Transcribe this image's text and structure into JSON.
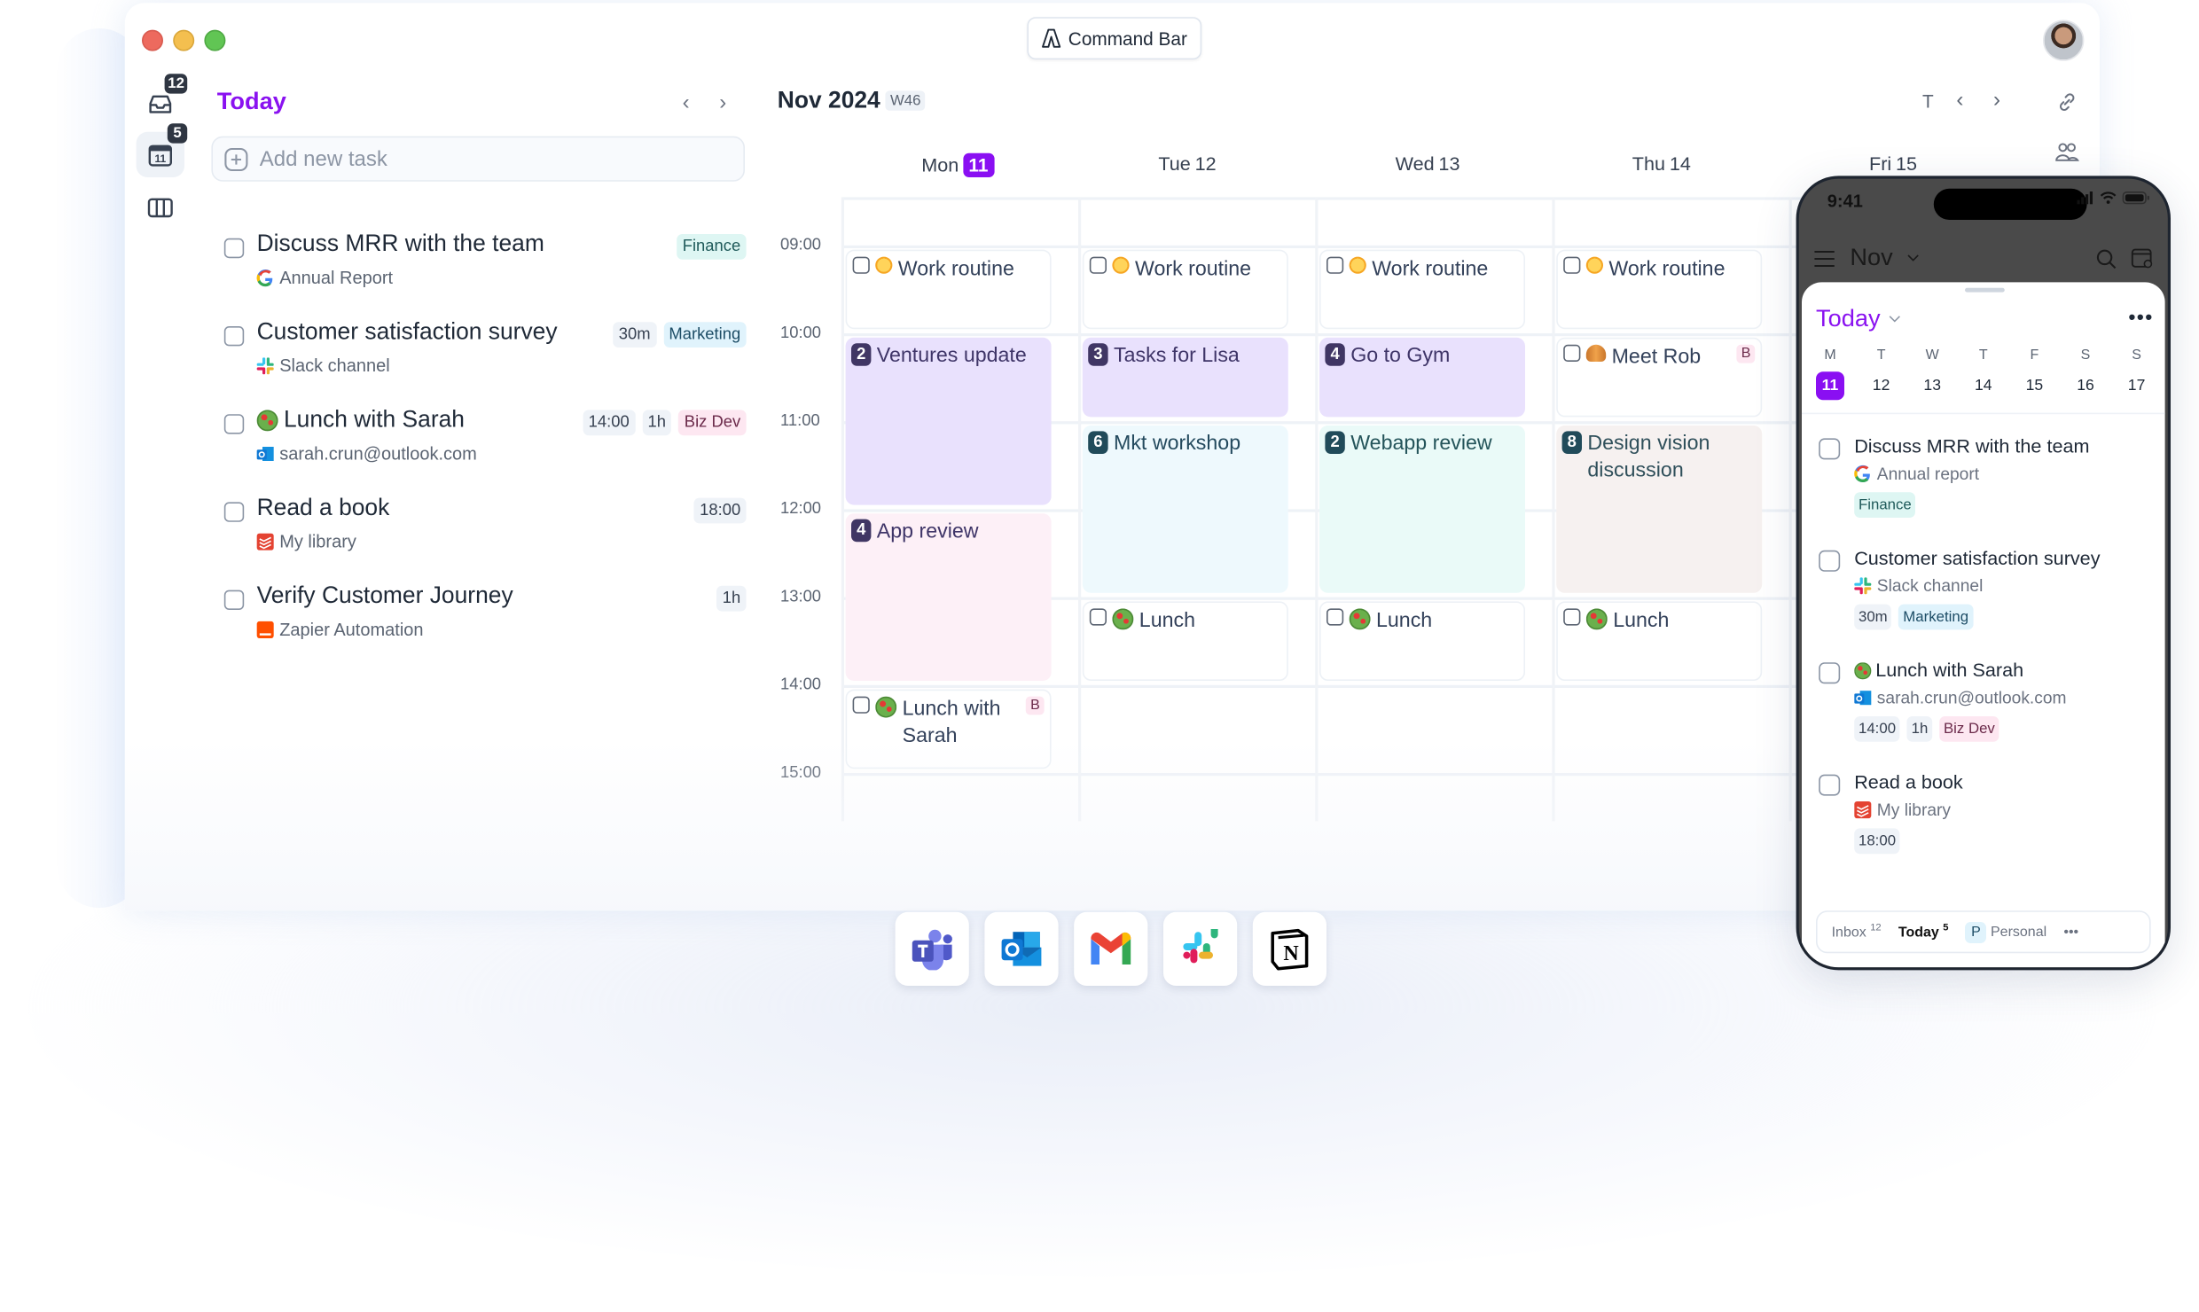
{
  "window": {
    "command_bar_label": "Command Bar",
    "avatar_alt": "User avatar"
  },
  "sidebar": {
    "items": [
      {
        "name": "inbox",
        "icon": "inbox-icon",
        "badge": "12"
      },
      {
        "name": "today",
        "icon": "calendar-day-icon",
        "badge": "5",
        "calendar_day": "11",
        "active": true
      },
      {
        "name": "boards",
        "icon": "columns-icon"
      }
    ]
  },
  "today_panel": {
    "title": "Today",
    "prev_label": "‹",
    "next_label": "›",
    "add_task_placeholder": "Add new task",
    "tasks": [
      {
        "title": "Discuss MRR with the team",
        "source_icon": "google-icon",
        "source": "Annual Report",
        "tags": [
          {
            "label": "Finance",
            "kind": "finance"
          }
        ]
      },
      {
        "title": "Customer satisfaction survey",
        "source_icon": "slack-icon",
        "source": "Slack channel",
        "tags": [
          {
            "label": "30m",
            "kind": "plain"
          },
          {
            "label": "Marketing",
            "kind": "marketing"
          }
        ]
      },
      {
        "title": "Lunch with Sarah",
        "emoji": "salad-icon",
        "source_icon": "outlook-icon",
        "source": "sarah.crun@outlook.com",
        "tags": [
          {
            "label": "14:00",
            "kind": "plain"
          },
          {
            "label": "1h",
            "kind": "plain"
          },
          {
            "label": "Biz Dev",
            "kind": "bizdev"
          }
        ]
      },
      {
        "title": "Read a book",
        "source_icon": "todoist-icon",
        "source": "My library",
        "tags": [
          {
            "label": "18:00",
            "kind": "plain"
          }
        ]
      },
      {
        "title": "Verify Customer Journey",
        "source_icon": "zapier-icon",
        "source": "Zapier Automation",
        "tags": [
          {
            "label": "1h",
            "kind": "plain"
          }
        ]
      }
    ]
  },
  "calendar": {
    "month_label": "Nov 2024",
    "week_label": "W46",
    "today_button": "T",
    "prev_label": "‹",
    "next_label": "›",
    "days": [
      {
        "name": "Mon",
        "date": "11",
        "today": true
      },
      {
        "name": "Tue",
        "date": "12"
      },
      {
        "name": "Wed",
        "date": "13"
      },
      {
        "name": "Thu",
        "date": "14"
      },
      {
        "name": "Fri",
        "date": "15"
      }
    ],
    "hours": [
      "09:00",
      "10:00",
      "11:00",
      "12:00",
      "13:00",
      "14:00",
      "15:00"
    ],
    "events": [
      {
        "day": 0,
        "start": "09:00",
        "end": "10:00",
        "title": "Work routine",
        "kind": "task",
        "emoji": "sun-icon"
      },
      {
        "day": 1,
        "start": "09:00",
        "end": "10:00",
        "title": "Work routine",
        "kind": "task",
        "emoji": "sun-icon"
      },
      {
        "day": 2,
        "start": "09:00",
        "end": "10:00",
        "title": "Work routine",
        "kind": "task",
        "emoji": "sun-icon"
      },
      {
        "day": 3,
        "start": "09:00",
        "end": "10:00",
        "title": "Work routine",
        "kind": "task",
        "emoji": "sun-icon"
      },
      {
        "day": 0,
        "start": "10:00",
        "end": "12:00",
        "title": "Ventures update",
        "kind": "purple",
        "count": "2"
      },
      {
        "day": 1,
        "start": "10:00",
        "end": "11:00",
        "title": "Tasks for Lisa",
        "kind": "purple",
        "count": "3"
      },
      {
        "day": 2,
        "start": "10:00",
        "end": "11:00",
        "title": "Go to Gym",
        "kind": "purple",
        "count": "4"
      },
      {
        "day": 3,
        "start": "10:00",
        "end": "11:00",
        "title": "Meet Rob",
        "kind": "task",
        "emoji": "croissant-icon",
        "badge": "B"
      },
      {
        "day": 1,
        "start": "11:00",
        "end": "13:00",
        "title": "Mkt workshop",
        "kind": "sky",
        "count": "6"
      },
      {
        "day": 2,
        "start": "11:00",
        "end": "13:00",
        "title": "Webapp review",
        "kind": "mint",
        "count": "2"
      },
      {
        "day": 3,
        "start": "11:00",
        "end": "13:00",
        "title": "Design vision discussion",
        "kind": "sand",
        "count": "8"
      },
      {
        "day": 0,
        "start": "12:00",
        "end": "14:00",
        "title": "App review",
        "kind": "pink",
        "count": "4"
      },
      {
        "day": 1,
        "start": "13:00",
        "end": "14:00",
        "title": "Lunch",
        "kind": "task",
        "emoji": "salad-icon"
      },
      {
        "day": 2,
        "start": "13:00",
        "end": "14:00",
        "title": "Lunch",
        "kind": "task",
        "emoji": "salad-icon"
      },
      {
        "day": 3,
        "start": "13:00",
        "end": "14:00",
        "title": "Lunch",
        "kind": "task",
        "emoji": "salad-icon"
      },
      {
        "day": 0,
        "start": "14:00",
        "end": "15:00",
        "title": "Lunch with Sarah",
        "kind": "task",
        "emoji": "salad-icon",
        "badge": "B"
      }
    ]
  },
  "integrations": [
    "Microsoft Teams",
    "Outlook",
    "Gmail",
    "Slack",
    "Notion"
  ],
  "phone": {
    "time": "9:41",
    "month": "Nov",
    "title": "Today",
    "more_label": "•••",
    "weekdays": [
      "M",
      "T",
      "W",
      "T",
      "F",
      "S",
      "S"
    ],
    "dates": [
      "11",
      "12",
      "13",
      "14",
      "15",
      "16",
      "17"
    ],
    "selected_date": "11",
    "tasks": [
      {
        "title": "Discuss MRR with the team",
        "source_icon": "google-icon",
        "source": "Annual report",
        "tags": [
          {
            "label": "Finance",
            "kind": "finance"
          }
        ]
      },
      {
        "title": "Customer satisfaction survey",
        "source_icon": "slack-icon",
        "source": "Slack channel",
        "tags": [
          {
            "label": "30m",
            "kind": "plain"
          },
          {
            "label": "Marketing",
            "kind": "marketing"
          }
        ]
      },
      {
        "title": "Lunch with Sarah",
        "emoji": "salad-icon",
        "source_icon": "outlook-icon",
        "source": "sarah.crun@outlook.com",
        "tags": [
          {
            "label": "14:00",
            "kind": "plain"
          },
          {
            "label": "1h",
            "kind": "plain"
          },
          {
            "label": "Biz Dev",
            "kind": "bizdev"
          }
        ]
      },
      {
        "title": "Read a book",
        "source_icon": "todoist-icon",
        "source": "My library",
        "tags": [
          {
            "label": "18:00",
            "kind": "plain"
          }
        ]
      }
    ],
    "bottom_bar": {
      "inbox_label": "Inbox",
      "inbox_count": "12",
      "today_label": "Today",
      "today_count": "5",
      "personal_initial": "P",
      "personal_label": "Personal",
      "more_label": "•••"
    }
  },
  "colors": {
    "accent": "#8a0ff2",
    "event_purple": "#e9e1fd",
    "event_pink": "#fdf0f7",
    "event_sky": "#eef9fd",
    "event_mint": "#eafaf8",
    "event_sand": "#f6f1f0"
  }
}
